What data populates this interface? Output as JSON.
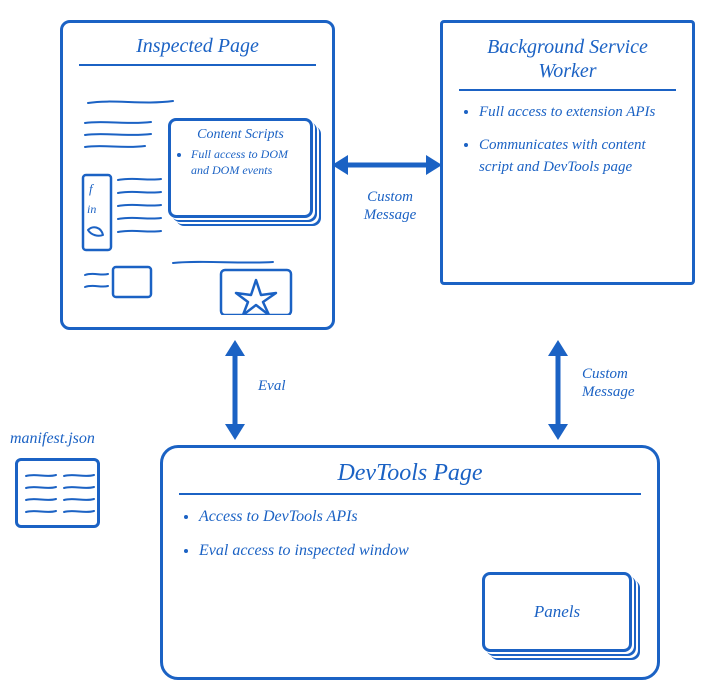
{
  "inspected": {
    "title": "Inspected Page",
    "content_scripts": {
      "title": "Content Scripts",
      "bullets": [
        "Full access to DOM and DOM events"
      ]
    }
  },
  "background": {
    "title": "Background Service Worker",
    "bullets": [
      "Full access to extension APIs",
      "Communicates with content script and DevTools page"
    ]
  },
  "devtools": {
    "title": "DevTools Page",
    "bullets": [
      "Access to DevTools APIs",
      "Eval access to inspected window"
    ],
    "panels_label": "Panels"
  },
  "manifest": {
    "label": "manifest.json"
  },
  "arrows": {
    "custom_message_top": "Custom Message",
    "eval": "Eval",
    "custom_message_right": "Custom Message"
  }
}
